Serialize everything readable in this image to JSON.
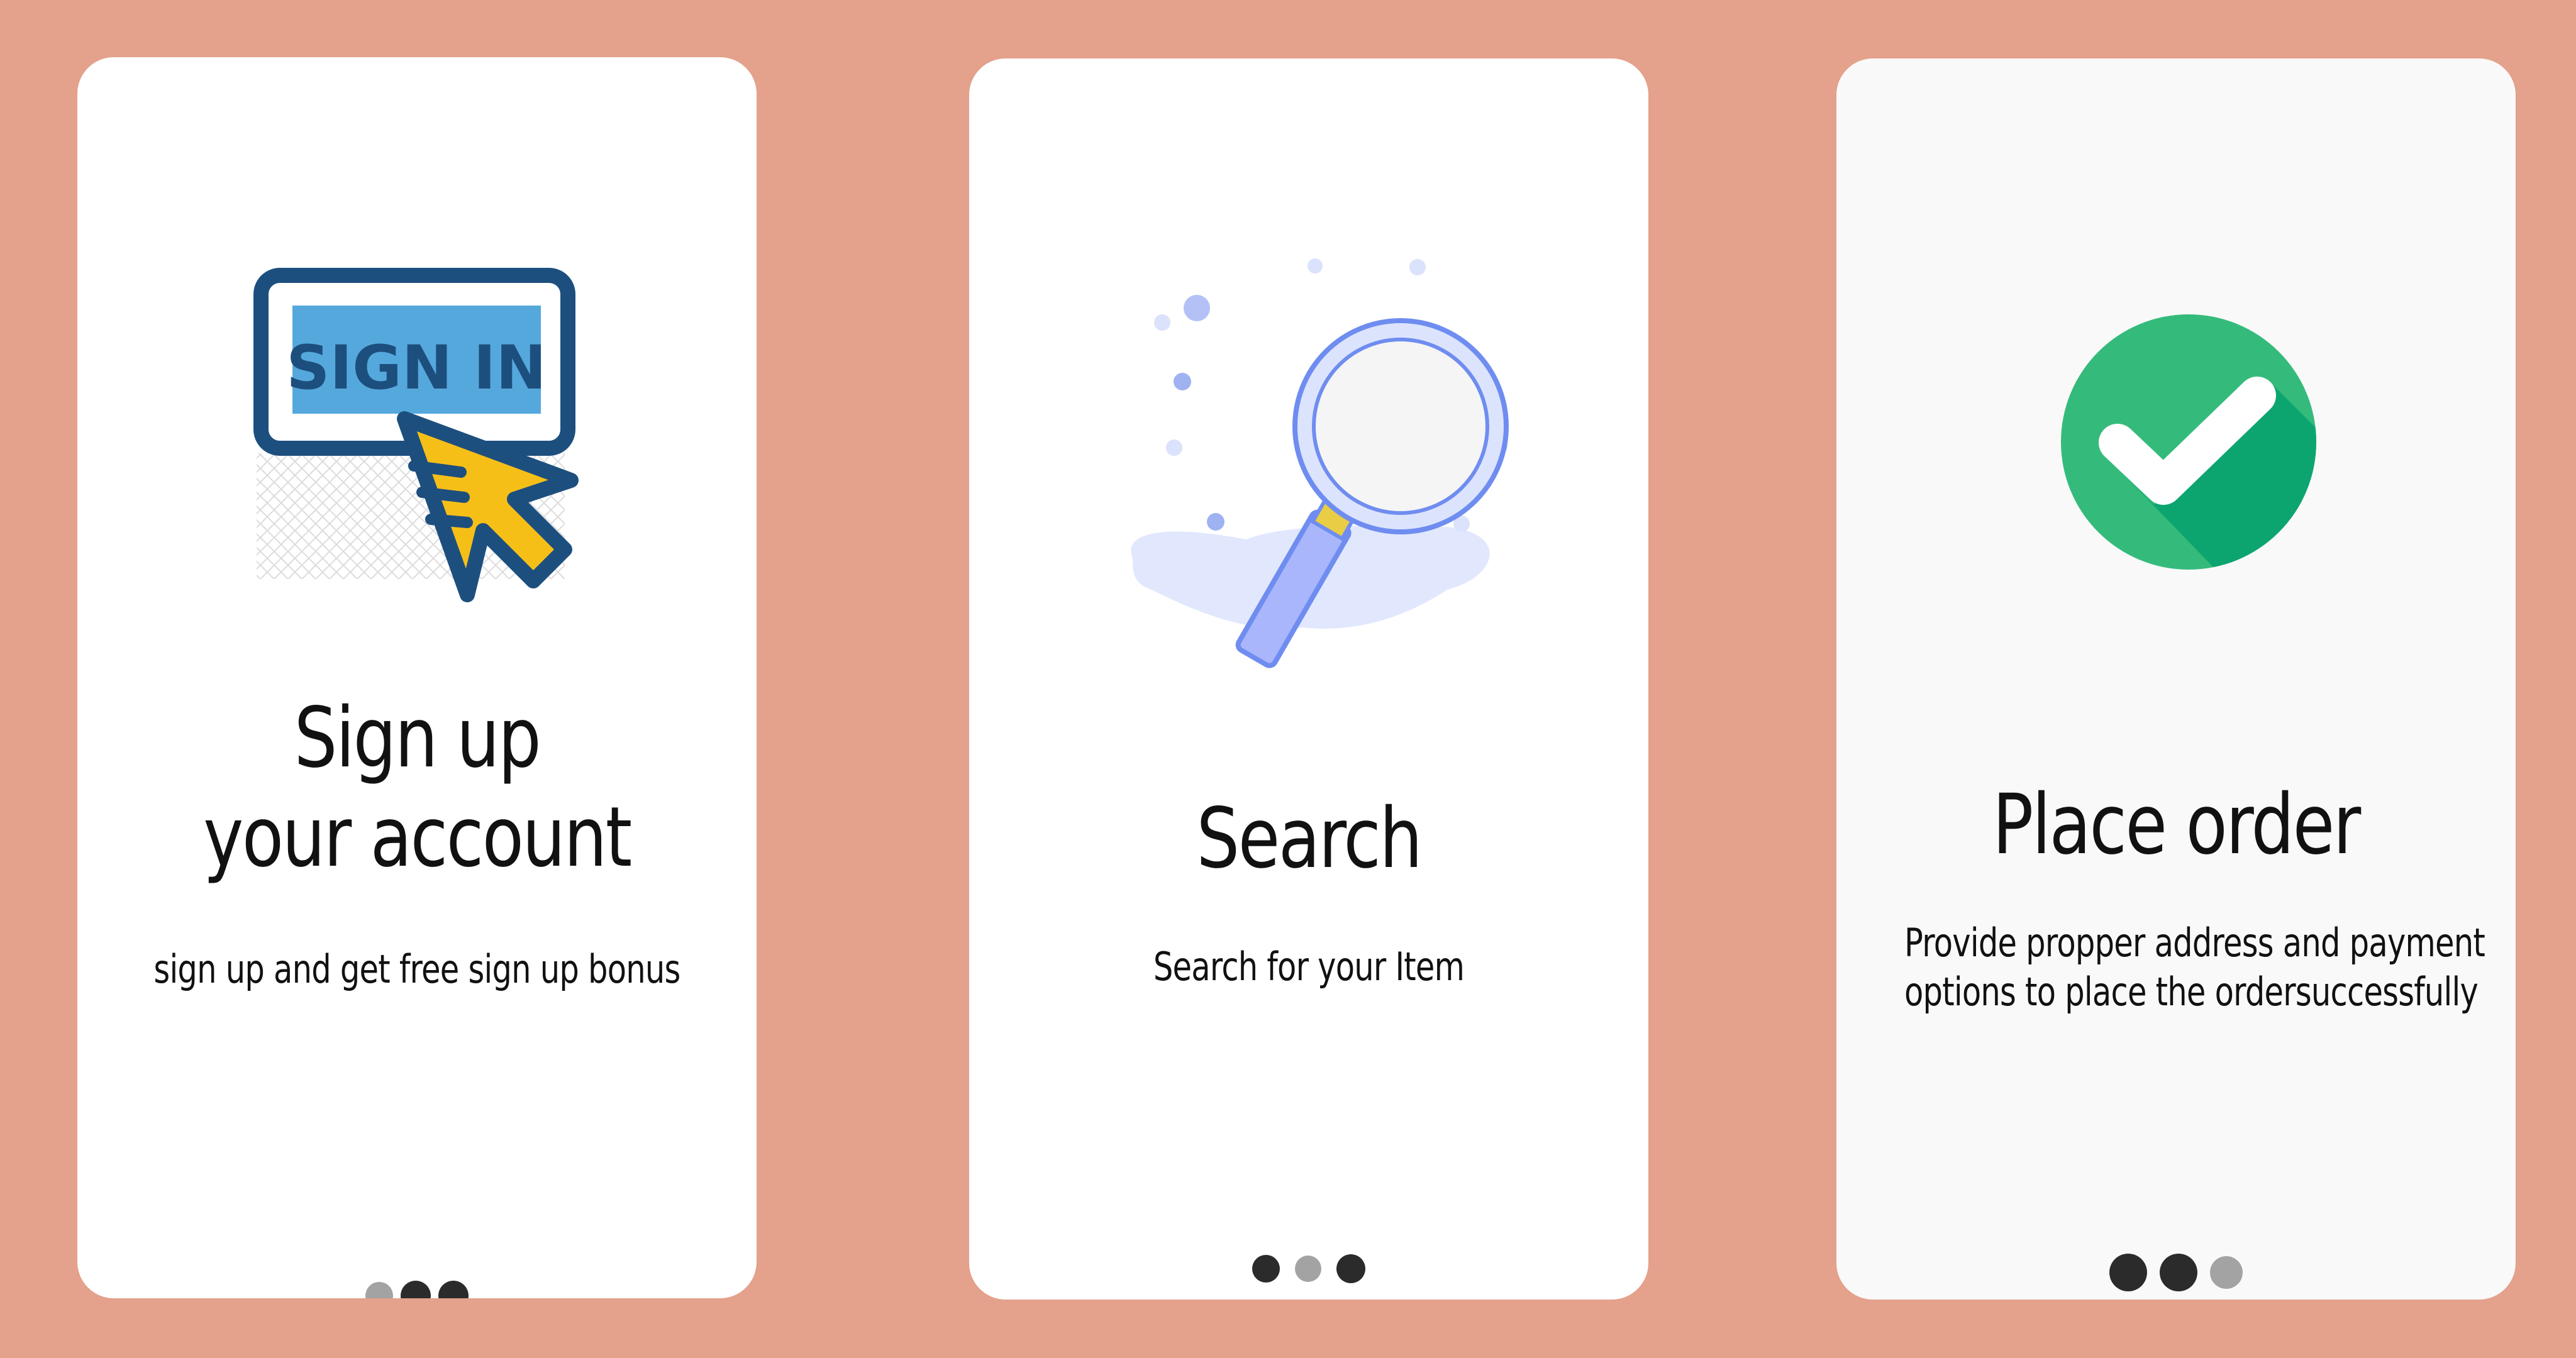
{
  "cards": [
    {
      "title_line1": "Sign up",
      "title_line2": "your account",
      "subtitle": "sign up and get free sign up bonus",
      "illustration_icon": "sign-in-cursor-icon",
      "illustration_text": "SIGN IN",
      "pagination": {
        "active_index": 0,
        "count": 3
      }
    },
    {
      "title": "Search",
      "subtitle": "Search for your Item",
      "illustration_icon": "magnifying-glass-icon",
      "pagination": {
        "active_index": 1,
        "count": 3
      }
    },
    {
      "title": "Place order",
      "subtitle_line1": "Provide propper address and payment",
      "subtitle_line2": "options to place the ordersuccessfully",
      "illustration_icon": "check-circle-icon",
      "pagination": {
        "active_index": 2,
        "count": 3
      }
    }
  ],
  "colors": {
    "page_background": "#e4a18b",
    "card_background": "#ffffff",
    "card_background_alt": "#f9f9f9",
    "dot_dark": "#2b2b2b",
    "dot_light": "#a3a3a3",
    "sign_in_blue": "#1d4f7e",
    "sign_in_fill": "#55a8dc",
    "cursor_yellow": "#f6bf18",
    "search_blue": "#6f8df0",
    "check_green": "#34bb7b",
    "check_green_dark": "#0da56f"
  }
}
